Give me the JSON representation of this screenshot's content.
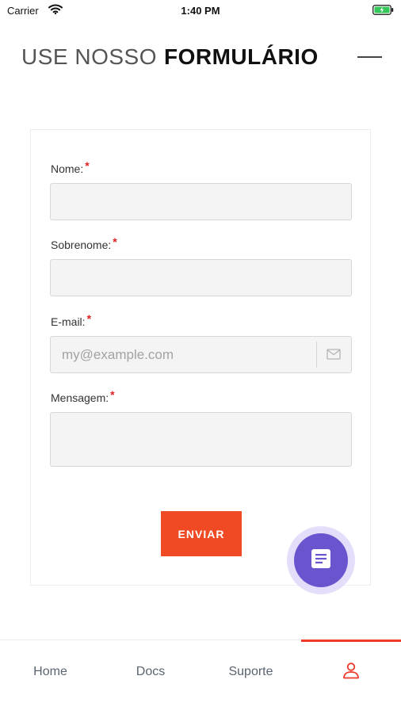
{
  "status_bar": {
    "carrier": "Carrier",
    "time": "1:40 PM"
  },
  "header": {
    "title_light": "USE NOSSO",
    "title_bold": "FORMULÁRIO"
  },
  "form": {
    "fields": [
      {
        "label": "Nome:",
        "value": "",
        "placeholder": ""
      },
      {
        "label": "Sobrenome:",
        "value": "",
        "placeholder": ""
      },
      {
        "label": "E-mail:",
        "value": "",
        "placeholder": "my@example.com"
      },
      {
        "label": "Mensagem:",
        "value": "",
        "placeholder": ""
      }
    ],
    "required_mark": "*",
    "submit_label": "ENVIAR"
  },
  "bottom_nav": {
    "items": [
      {
        "label": "Home"
      },
      {
        "label": "Docs"
      },
      {
        "label": "Suporte"
      }
    ],
    "active_item": "profile"
  },
  "colors": {
    "accent": "#ef4a24",
    "required": "#e02020",
    "fab": "#6a55cf",
    "fab_halo": "#e4defa",
    "nav_active": "#ef3a2a"
  },
  "icons": {
    "wifi": "wifi-icon",
    "battery": "battery-charging-icon",
    "email_field": "mail-icon",
    "fab": "document-icon",
    "profile_tab": "user-icon"
  }
}
